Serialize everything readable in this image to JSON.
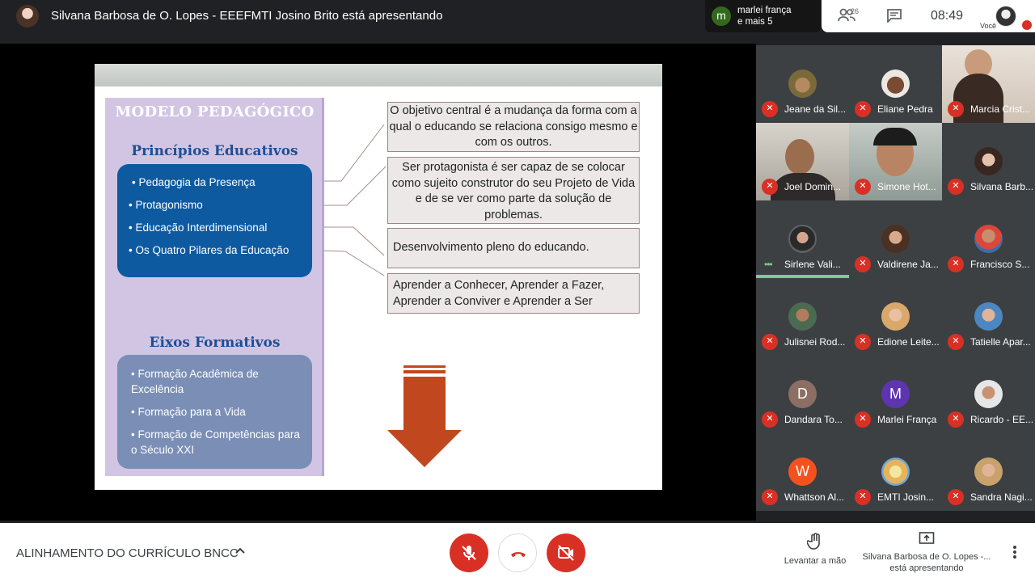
{
  "header": {
    "presenter_title": "Silvana Barbosa de O. Lopes - EEEFMTI Josino Brito está apresentando",
    "chat_preview_line1": "marlei frança",
    "chat_preview_line2": "e mais 5",
    "chat_preview_initial": "m",
    "participants_count": "26",
    "clock": "08:49",
    "self_label": "Você"
  },
  "slide": {
    "title": "MODELO PEDAGÓGICO",
    "section1_heading": "Princípios Educativos",
    "section1_items": [
      "• Pedagogia da Presença",
      "• Protagonismo",
      "• Educação Interdimensional",
      "• Os Quatro Pilares da Educação"
    ],
    "section2_heading": "Eixos Formativos",
    "section2_items": [
      "• Formação Acadêmica de Excelência",
      "• Formação para a Vida",
      "• Formação de Competências para o Século XXI"
    ],
    "boxes": [
      "O objetivo central é a mudança da forma com a qual o educando se relaciona consigo mesmo e com os outros.",
      "Ser protagonista é ser capaz de se colocar como sujeito construtor do seu Projeto de Vida e de se ver como parte da solução de problemas.",
      "Desenvolvimento pleno do educando.",
      "Aprender a Conhecer, Aprender a Fazer, Aprender a Conviver e Aprender a Ser"
    ],
    "colors": {
      "left_panel": "#d2c5e3",
      "blue_box": "#0d5aa0",
      "gray_box": "#7a8eb6",
      "arrow": "#c1471f"
    }
  },
  "participants": [
    {
      "name": "Jeane da Sil...",
      "type": "avatar",
      "muted": true
    },
    {
      "name": "Eliane Pedra",
      "type": "avatar",
      "muted": true
    },
    {
      "name": "Marcia Crist...",
      "type": "video",
      "muted": true
    },
    {
      "name": "Joel Domin...",
      "type": "video",
      "muted": true
    },
    {
      "name": "Simone Hot...",
      "type": "video",
      "muted": true
    },
    {
      "name": "Silvana Barb...",
      "type": "avatar",
      "muted": true
    },
    {
      "name": "Sirlene Vali...",
      "type": "avatar",
      "muted": false,
      "speaking": true
    },
    {
      "name": "Valdirene Ja...",
      "type": "avatar",
      "muted": true
    },
    {
      "name": "Francisco S...",
      "type": "avatar",
      "muted": true
    },
    {
      "name": "Julisnei Rod...",
      "type": "avatar",
      "muted": true
    },
    {
      "name": "Edione Leite...",
      "type": "avatar",
      "muted": true
    },
    {
      "name": "Tatielle Apar...",
      "type": "avatar",
      "muted": true
    },
    {
      "name": "Dandara To...",
      "type": "letter",
      "letter": "D",
      "color": "#8d6e63",
      "muted": true
    },
    {
      "name": "Marlei França",
      "type": "letter",
      "letter": "M",
      "color": "#5e35b1",
      "muted": true
    },
    {
      "name": "Ricardo - EE...",
      "type": "avatar",
      "muted": true
    },
    {
      "name": "Whattson Al...",
      "type": "letter",
      "letter": "W",
      "color": "#f4511e",
      "muted": true
    },
    {
      "name": "EMTI Josin...",
      "type": "avatar",
      "muted": true
    },
    {
      "name": "Sandra Nagi...",
      "type": "avatar",
      "muted": true
    }
  ],
  "bottombar": {
    "meeting_title": "ALINHAMENTO DO CURRÍCULO BNCC",
    "raise_hand_label": "Levantar a mão",
    "presenting_line1": "Silvana Barbosa de O. Lopes -...",
    "presenting_line2": "está apresentando"
  }
}
